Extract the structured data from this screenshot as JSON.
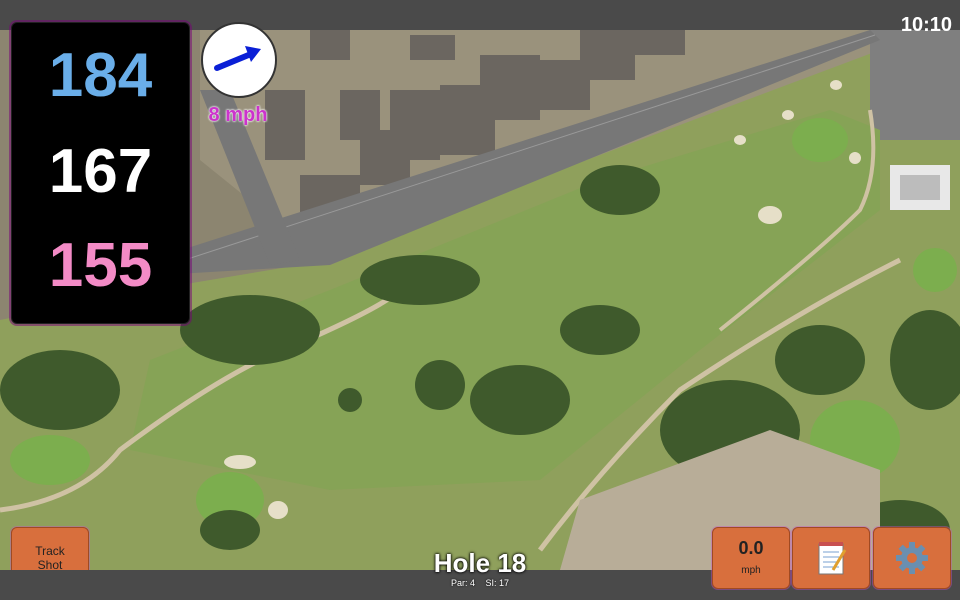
{
  "status_bar": {
    "time": "10:10"
  },
  "distances": {
    "back": "184",
    "center": "167",
    "front": "155"
  },
  "wind": {
    "speed_label": "8 mph",
    "direction_icon": "wind-arrow-icon"
  },
  "buttons": {
    "track_shot_line1": "Track",
    "track_shot_line2": "Shot",
    "wind_value": "0.0",
    "wind_unit": "mph",
    "notes_icon": "notepad-icon",
    "settings_icon": "gear-icon"
  },
  "hole": {
    "title": "Hole 18",
    "par": "Par: 4",
    "si": "SI: 17"
  },
  "colors": {
    "back": "#6aaee9",
    "center": "#ffffff",
    "front": "#f38bc6",
    "button": "#d86f3d",
    "wind_label": "#cc33cc"
  }
}
